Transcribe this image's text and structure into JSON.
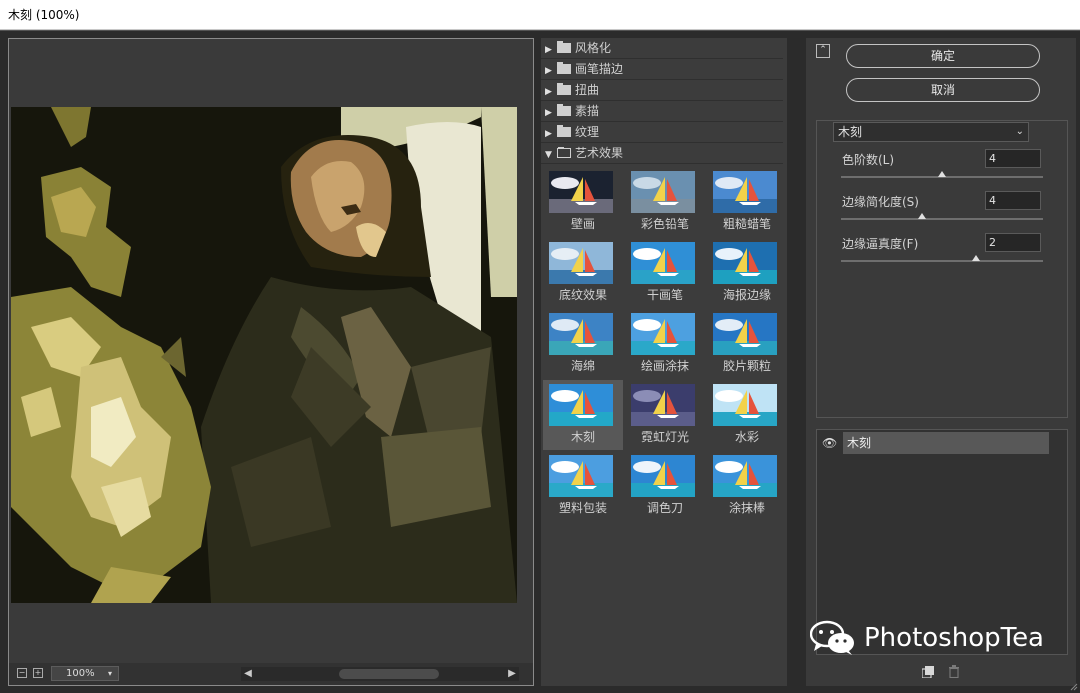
{
  "window": {
    "title": "木刻 (100%)"
  },
  "preview": {
    "zoom": "100%",
    "zoom_out_icon": "minus-square-icon",
    "zoom_in_icon": "plus-square-icon"
  },
  "gallery": {
    "categories": [
      {
        "label": "风格化",
        "expanded": false
      },
      {
        "label": "画笔描边",
        "expanded": false
      },
      {
        "label": "扭曲",
        "expanded": false
      },
      {
        "label": "素描",
        "expanded": false
      },
      {
        "label": "纹理",
        "expanded": false
      },
      {
        "label": "艺术效果",
        "expanded": true
      }
    ],
    "filters": [
      "壁画",
      "彩色铅笔",
      "粗糙蜡笔",
      "底纹效果",
      "干画笔",
      "海报边缘",
      "海绵",
      "绘画涂抹",
      "胶片颗粒",
      "木刻",
      "霓虹灯光",
      "水彩",
      "塑料包装",
      "调色刀",
      "涂抹棒"
    ],
    "selected": "木刻"
  },
  "buttons": {
    "ok": "确定",
    "cancel": "取消"
  },
  "settings": {
    "filter": "木刻",
    "params": [
      {
        "label": "色阶数(L)",
        "value": "4",
        "level": 0.5
      },
      {
        "label": "边缘简化度(S)",
        "value": "4",
        "level": 0.4
      },
      {
        "label": "边缘逼真度(F)",
        "value": "2",
        "level": 0.67
      }
    ]
  },
  "layers": [
    {
      "name": "木刻",
      "visible": true
    }
  ],
  "watermark": "PhotoshopTea",
  "colors": {
    "panel": "#3a3a3a",
    "selected": "#585858",
    "canvas": "#16160c"
  }
}
